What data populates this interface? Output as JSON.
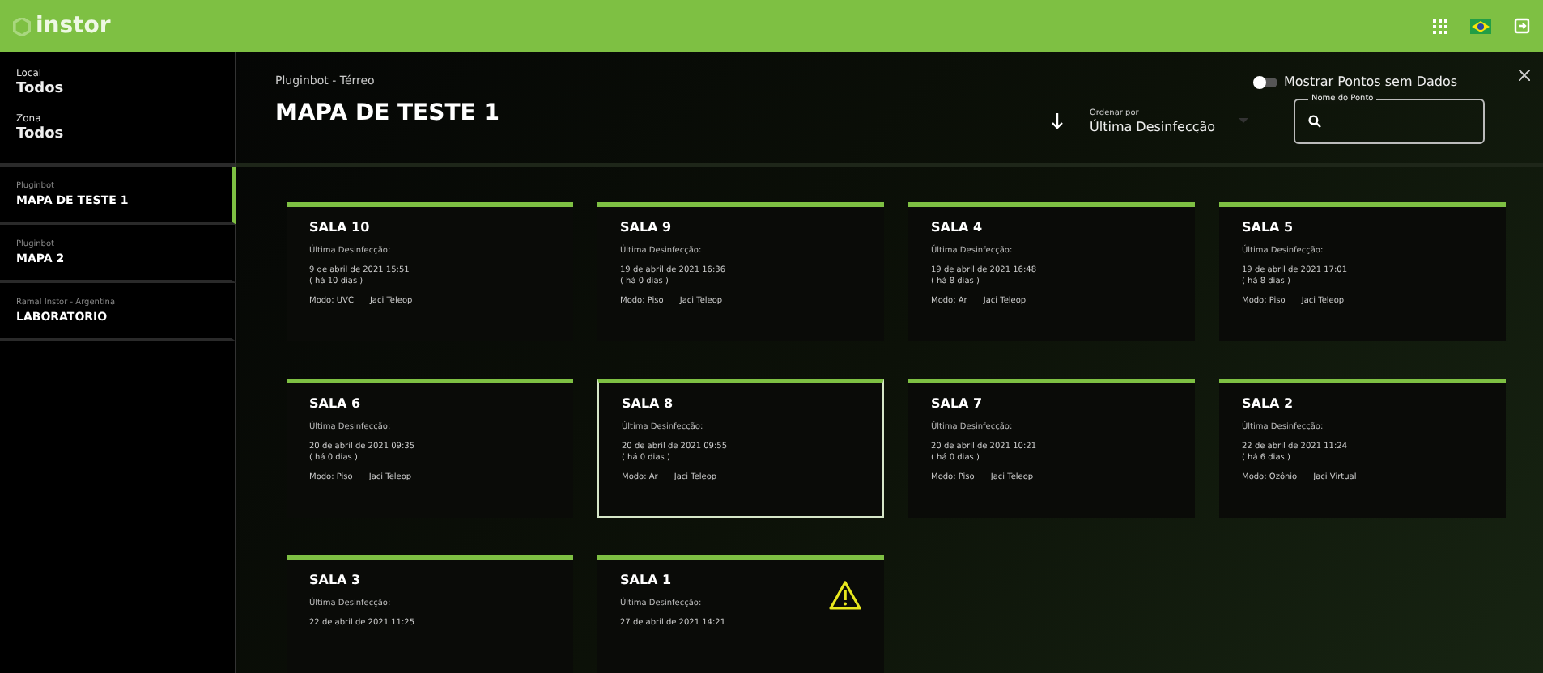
{
  "app": {
    "logo": "instor"
  },
  "filters": [
    {
      "label": "Local",
      "value": "Todos"
    },
    {
      "label": "Zona",
      "value": "Todos"
    }
  ],
  "maps": [
    {
      "group": "Pluginbot",
      "name": "MAPA DE TESTE 1",
      "selected": true
    },
    {
      "group": "Pluginbot",
      "name": "MAPA 2",
      "selected": false
    },
    {
      "group": "Ramal Instor - Argentina",
      "name": "LABORATORIO",
      "selected": false
    }
  ],
  "header": {
    "breadcrumb": "Pluginbot - Térreo",
    "title": "MAPA DE TESTE 1"
  },
  "toggle": {
    "label": "Mostrar Pontos sem Dados",
    "on": false
  },
  "sort": {
    "label": "Ordenar por",
    "value": "Última Desinfecção"
  },
  "search": {
    "legend": "Nome do Ponto"
  },
  "rooms": [
    {
      "name": "SALA 10",
      "label": "Última Desinfecção:",
      "date": "9 de abril de 2021 15:51",
      "ago": "( há 10 dias )",
      "mode": "Modo: UVC",
      "operator": "Jaci Teleop",
      "selected": false,
      "warning": false
    },
    {
      "name": "SALA 9",
      "label": "Última Desinfecção:",
      "date": "19 de abril de 2021 16:36",
      "ago": "( há 0 dias )",
      "mode": "Modo: Piso",
      "operator": "Jaci Teleop",
      "selected": false,
      "warning": false
    },
    {
      "name": "SALA 4",
      "label": "Última Desinfecção:",
      "date": "19 de abril de 2021 16:48",
      "ago": "( há 8 dias )",
      "mode": "Modo: Ar",
      "operator": "Jaci Teleop",
      "selected": false,
      "warning": false
    },
    {
      "name": "SALA 5",
      "label": "Última Desinfecção:",
      "date": "19 de abril de 2021 17:01",
      "ago": "( há 8 dias )",
      "mode": "Modo: Piso",
      "operator": "Jaci Teleop",
      "selected": false,
      "warning": false
    },
    {
      "name": "SALA 6",
      "label": "Última Desinfecção:",
      "date": "20 de abril de 2021 09:35",
      "ago": "( há 0 dias )",
      "mode": "Modo: Piso",
      "operator": "Jaci Teleop",
      "selected": false,
      "warning": false
    },
    {
      "name": "SALA 8",
      "label": "Última Desinfecção:",
      "date": "20 de abril de 2021 09:55",
      "ago": "( há 0 dias )",
      "mode": "Modo: Ar",
      "operator": "Jaci Teleop",
      "selected": true,
      "warning": false
    },
    {
      "name": "SALA 7",
      "label": "Última Desinfecção:",
      "date": "20 de abril de 2021 10:21",
      "ago": "( há 0 dias )",
      "mode": "Modo: Piso",
      "operator": "Jaci Teleop",
      "selected": false,
      "warning": false
    },
    {
      "name": "SALA 2",
      "label": "Última Desinfecção:",
      "date": "22 de abril de 2021 11:24",
      "ago": "( há 6 dias )",
      "mode": "Modo: Ozônio",
      "operator": "Jaci Virtual",
      "selected": false,
      "warning": false
    },
    {
      "name": "SALA 3",
      "label": "Última Desinfecção:",
      "date": "22 de abril de 2021 11:25",
      "selected": false,
      "warning": false
    },
    {
      "name": "SALA 1",
      "label": "Última Desinfecção:",
      "date": "27 de abril de 2021 14:21",
      "selected": false,
      "warning": true
    }
  ]
}
